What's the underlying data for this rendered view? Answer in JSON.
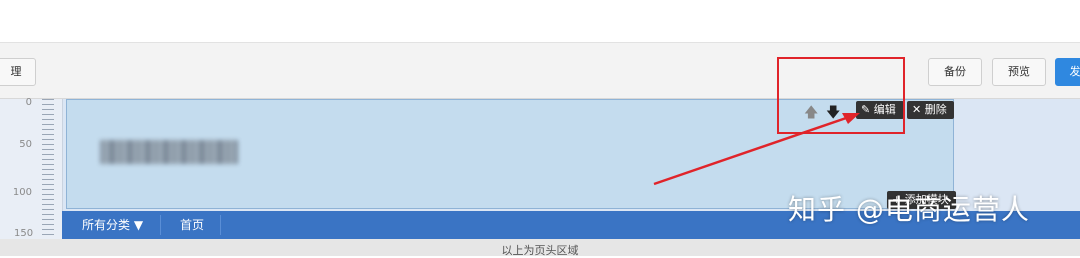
{
  "toolbar": {
    "left_label": "理",
    "backup_label": "备份",
    "preview_label": "预览",
    "publish_label": "发"
  },
  "ruler": {
    "labels": [
      "0",
      "50",
      "100",
      "150"
    ]
  },
  "header_region": {
    "edit_label": "✎ 编辑",
    "delete_label": "✕ 删除",
    "add_label": "+ 添加模块"
  },
  "nav": {
    "category_label": "所有分类 ▼",
    "home_label": "首页"
  },
  "footer": {
    "text": "以上为页头区域"
  },
  "watermark": {
    "text": "知乎 @电商运营人"
  },
  "colors": {
    "highlight": "#e0242a",
    "nav_bar": "#3a74c4",
    "publish": "#2f88e0"
  }
}
